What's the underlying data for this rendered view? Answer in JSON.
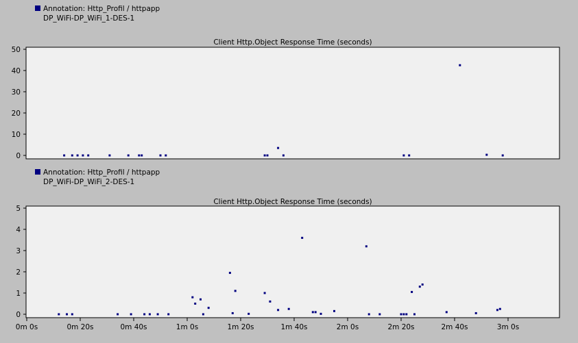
{
  "colors": {
    "background": "#c0c0c0",
    "plot_area": "#f0f0f0",
    "marker": "#000080",
    "grid": "#d8d8d8"
  },
  "chart_data": [
    {
      "type": "scatter",
      "legend": {
        "line1": "Annotation: Http_Profil / httpapp",
        "line2": "DP_WiFi-DP_WiFi_1-DES-1",
        "placement": "top-left"
      },
      "title": "Client Http.Object Response Time (seconds)",
      "xlim": [
        0,
        200
      ],
      "ylim": [
        0,
        51
      ],
      "yticks": [
        0,
        10,
        20,
        30,
        40,
        50
      ],
      "x": [
        14,
        17,
        19,
        21,
        23,
        31,
        38,
        42,
        43,
        50,
        52,
        89,
        90,
        94,
        96,
        141,
        143,
        162,
        172,
        178
      ],
      "y": [
        0,
        0,
        0,
        0,
        0,
        0,
        0,
        0,
        0,
        0,
        0,
        0,
        0,
        3.5,
        0,
        0,
        0,
        42.5,
        0.3,
        0
      ]
    },
    {
      "type": "scatter",
      "legend": {
        "line1": "Annotation: Http_Profil / httpapp",
        "line2": "DP_WiFi-DP_WiFi_2-DES-1",
        "placement": "top-left"
      },
      "title": "Client Http.Object Response Time (seconds)",
      "xlim": [
        0,
        200
      ],
      "ylim": [
        0,
        5.1
      ],
      "yticks": [
        0,
        1,
        2,
        3,
        4,
        5
      ],
      "xticks": [
        "0m 0s",
        "0m 20s",
        "0m 40s",
        "1m 0s",
        "1m 20s",
        "1m 40s",
        "2m 0s",
        "2m 20s",
        "2m 40s",
        "3m 0s"
      ],
      "x": [
        12,
        15,
        17,
        34,
        39,
        44,
        46,
        49,
        53,
        62,
        63,
        65,
        66,
        68,
        76,
        77,
        78,
        83,
        89,
        91,
        94,
        98,
        103,
        107,
        108,
        110,
        115,
        127,
        128,
        132,
        140,
        141,
        142,
        144,
        145,
        147,
        148,
        157,
        168,
        176,
        177
      ],
      "y": [
        0,
        0,
        0,
        0,
        0,
        0,
        0,
        0,
        0,
        0.8,
        0.5,
        0.7,
        0,
        0.3,
        1.95,
        0.05,
        1.1,
        0.02,
        1.0,
        0.6,
        0.2,
        0.25,
        3.6,
        0.1,
        0.1,
        0.02,
        0.15,
        3.2,
        0,
        0,
        0,
        0,
        0,
        1.05,
        0,
        1.3,
        1.4,
        0.1,
        0.05,
        0.2,
        0.25
      ]
    }
  ]
}
